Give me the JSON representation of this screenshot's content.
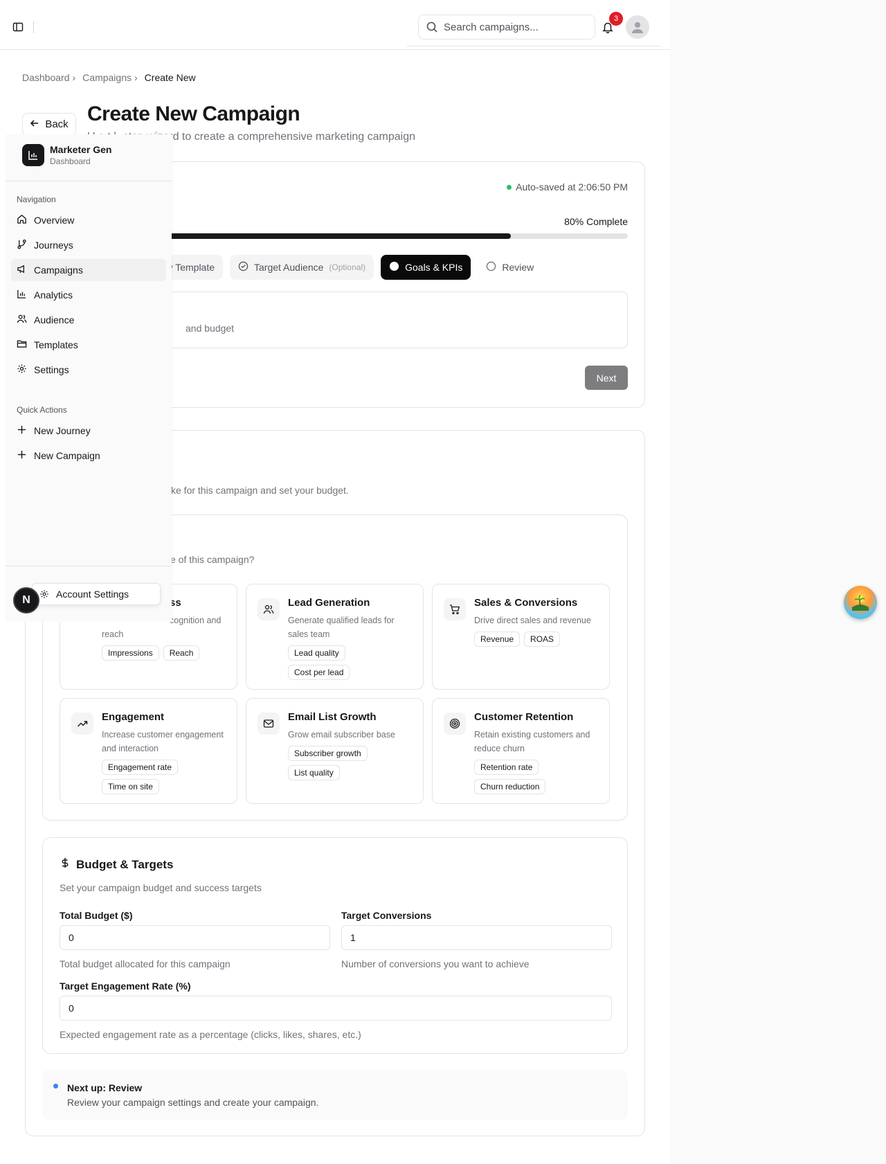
{
  "header": {
    "search_placeholder": "Search campaigns...",
    "notification_count": "3"
  },
  "breadcrumb": {
    "items": [
      "Dashboard",
      "Campaigns"
    ],
    "current": "Create New"
  },
  "page": {
    "back_label": "Back",
    "title": "Create New Campaign",
    "subtitle": "U  e  t  l  -step wizard to create a comprehensive marketing campaign"
  },
  "wizard": {
    "autosave": "Auto-saved at 2:06:50 PM",
    "progress_label": "80% Complete",
    "progress_percent": 80,
    "steps": [
      {
        "label": "ney Template",
        "optional": ""
      },
      {
        "label": "Target Audience",
        "optional": "(Optional)"
      },
      {
        "label": "Goals & KPIs",
        "optional": ""
      },
      {
        "label": "Review",
        "optional": ""
      }
    ],
    "step_desc": "and budget",
    "next_label": "Next"
  },
  "goals": {
    "subtitle": "ke for this campaign and set your budget.",
    "objective_question": "e of this campaign?",
    "objectives": [
      {
        "title": "ss",
        "desc": "cognition and reach",
        "tags": [
          "Impressions",
          "Reach"
        ],
        "icon": "eye-icon"
      },
      {
        "title": "Lead Generation",
        "desc": "Generate qualified leads for sales team",
        "tags": [
          "Lead quality",
          "Cost per lead"
        ],
        "icon": "users-icon"
      },
      {
        "title": "Sales & Conversions",
        "desc": "Drive direct sales and revenue",
        "tags": [
          "Revenue",
          "ROAS"
        ],
        "icon": "cart-icon"
      },
      {
        "title": "Engagement",
        "desc": "Increase customer engagement and interaction",
        "tags": [
          "Engagement rate",
          "Time on site"
        ],
        "icon": "trending-up-icon"
      },
      {
        "title": "Email List Growth",
        "desc": "Grow email subscriber base",
        "tags": [
          "Subscriber growth",
          "List quality"
        ],
        "icon": "mail-icon"
      },
      {
        "title": "Customer Retention",
        "desc": "Retain existing customers and reduce churn",
        "tags": [
          "Retention rate",
          "Churn reduction"
        ],
        "icon": "target-icon"
      }
    ]
  },
  "budget": {
    "title": "Budget & Targets",
    "subtitle": "Set your campaign budget and success targets",
    "total_budget_label": "Total Budget ($)",
    "total_budget_value": "0",
    "total_budget_help": "Total budget allocated for this campaign",
    "target_conversions_label": "Target Conversions",
    "target_conversions_value": "1",
    "target_conversions_help": "Number of conversions you want to achieve",
    "engagement_label": "Target Engagement Rate (%)",
    "engagement_value": "0",
    "engagement_help": "Expected engagement rate as a percentage (clicks, likes, shares, etc.)"
  },
  "next_up": {
    "title": "Next up: Review",
    "desc": "Review your campaign settings and create your campaign."
  },
  "sidebar": {
    "brand_name": "Marketer Gen",
    "brand_sub": "Dashboard",
    "nav_heading": "Navigation",
    "nav_items": [
      "Overview",
      "Journeys",
      "Campaigns",
      "Analytics",
      "Audience",
      "Templates",
      "Settings"
    ],
    "quick_heading": "Quick Actions",
    "quick_items": [
      "New Journey",
      "New Campaign"
    ],
    "account_menu": "Account Settings",
    "avatar_letter": "N"
  },
  "colors": {
    "accent": "#0a0a0a",
    "badge": "#e11d26",
    "autosave_dot": "#22c55e",
    "next_up_dot": "#3b82f6"
  }
}
